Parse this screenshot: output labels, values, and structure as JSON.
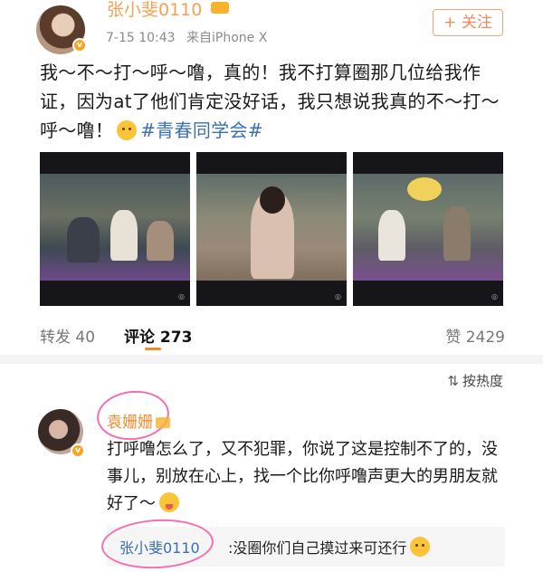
{
  "post": {
    "username": "张小斐0110",
    "time": "7-15 10:43",
    "source": "来自iPhone X",
    "follow_label": "+ 关注",
    "text_main": "我～不～打～呼～噜，真的！我不打算圈那几位给我作证，因为at了他们肯定没好话，我只想说我真的不～打～呼～噜！",
    "hashtag": "#青春同学会#",
    "images": [
      {
        "name": "snore-screenshot-1"
      },
      {
        "name": "snore-screenshot-2"
      },
      {
        "name": "snore-screenshot-3"
      }
    ]
  },
  "stats": {
    "repost": "转发 40",
    "comment": "评论 273",
    "like": "赞 2429"
  },
  "sort": {
    "label": "按热度",
    "icon": "sort-lines-icon"
  },
  "comment": {
    "username": "袁姗姗",
    "text": "打呼噜怎么了，又不犯罪，你说了这是控制不了的，没事儿，别放在心上，找一个比你呼噜声更大的男朋友就好了～",
    "reply": {
      "username": "张小斐0110",
      "text": ":没圈你们自己摸过来可还行"
    }
  },
  "colors": {
    "username_orange": "#f08a2c",
    "link_blue": "#3a6fb5",
    "highlight_pink": "#f36fb0"
  }
}
